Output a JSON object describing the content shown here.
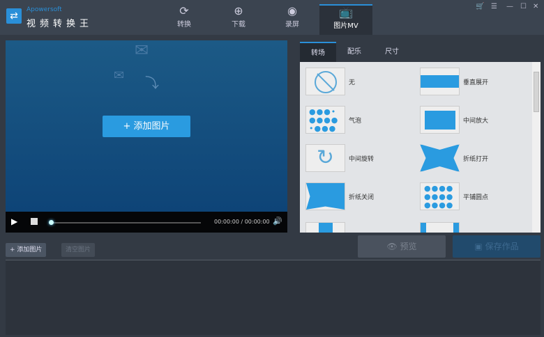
{
  "app": {
    "brand": "Apowersoft",
    "name": "视频转换王"
  },
  "nav": [
    {
      "label": "转换",
      "icon": "refresh-icon"
    },
    {
      "label": "下载",
      "icon": "download-icon"
    },
    {
      "label": "录屏",
      "icon": "record-icon"
    },
    {
      "label": "图片MV",
      "icon": "tv-icon"
    }
  ],
  "preview": {
    "add_label": "+ 添加图片",
    "time": "00:00:00 / 00:00:00",
    "progress": 0
  },
  "tabs": [
    "转场",
    "配乐",
    "尺寸"
  ],
  "transitions": [
    "无",
    "垂直展开",
    "气泡",
    "中间放大",
    "中间旋转",
    "折纸打开",
    "折纸关闭",
    "平铺圆点"
  ],
  "buttons": {
    "add": "+ 添加图片",
    "clear": "清空图片",
    "preview": "预览",
    "save": "保存作品"
  },
  "colors": {
    "accent": "#2a9be0"
  }
}
